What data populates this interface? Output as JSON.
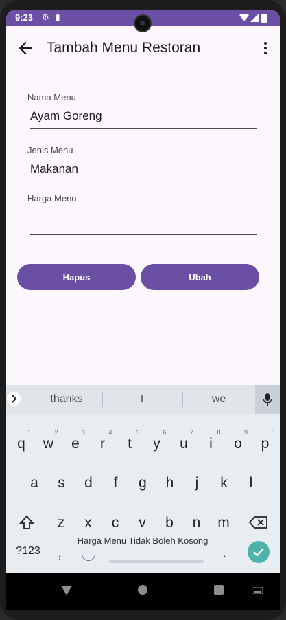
{
  "status_bar": {
    "time": "9:23"
  },
  "app_bar": {
    "title": "Tambah Menu Restoran"
  },
  "form": {
    "nama_label": "Nama Menu",
    "nama_value": "Ayam Goreng",
    "jenis_label": "Jenis Menu",
    "jenis_value": "Makanan",
    "harga_label": "Harga Menu",
    "harga_value": ""
  },
  "buttons": {
    "hapus": "Hapus",
    "ubah": "Ubah"
  },
  "keyboard": {
    "suggestions": [
      "thanks",
      "I",
      "we"
    ],
    "row1": [
      "q",
      "w",
      "e",
      "r",
      "t",
      "y",
      "u",
      "i",
      "o",
      "p"
    ],
    "row1_hints": [
      "1",
      "2",
      "3",
      "4",
      "5",
      "6",
      "7",
      "8",
      "9",
      "0"
    ],
    "row2": [
      "a",
      "s",
      "d",
      "f",
      "g",
      "h",
      "j",
      "k",
      "l"
    ],
    "row3": [
      "z",
      "x",
      "c",
      "v",
      "b",
      "n",
      "m"
    ],
    "symbols": "?123",
    "comma": ",",
    "period": "."
  },
  "toast": "Harga Menu Tidak Boleh Kosong",
  "colors": {
    "primary": "#6b4fa5",
    "enter_key": "#4eb2a8",
    "background": "#fcf7fd"
  }
}
